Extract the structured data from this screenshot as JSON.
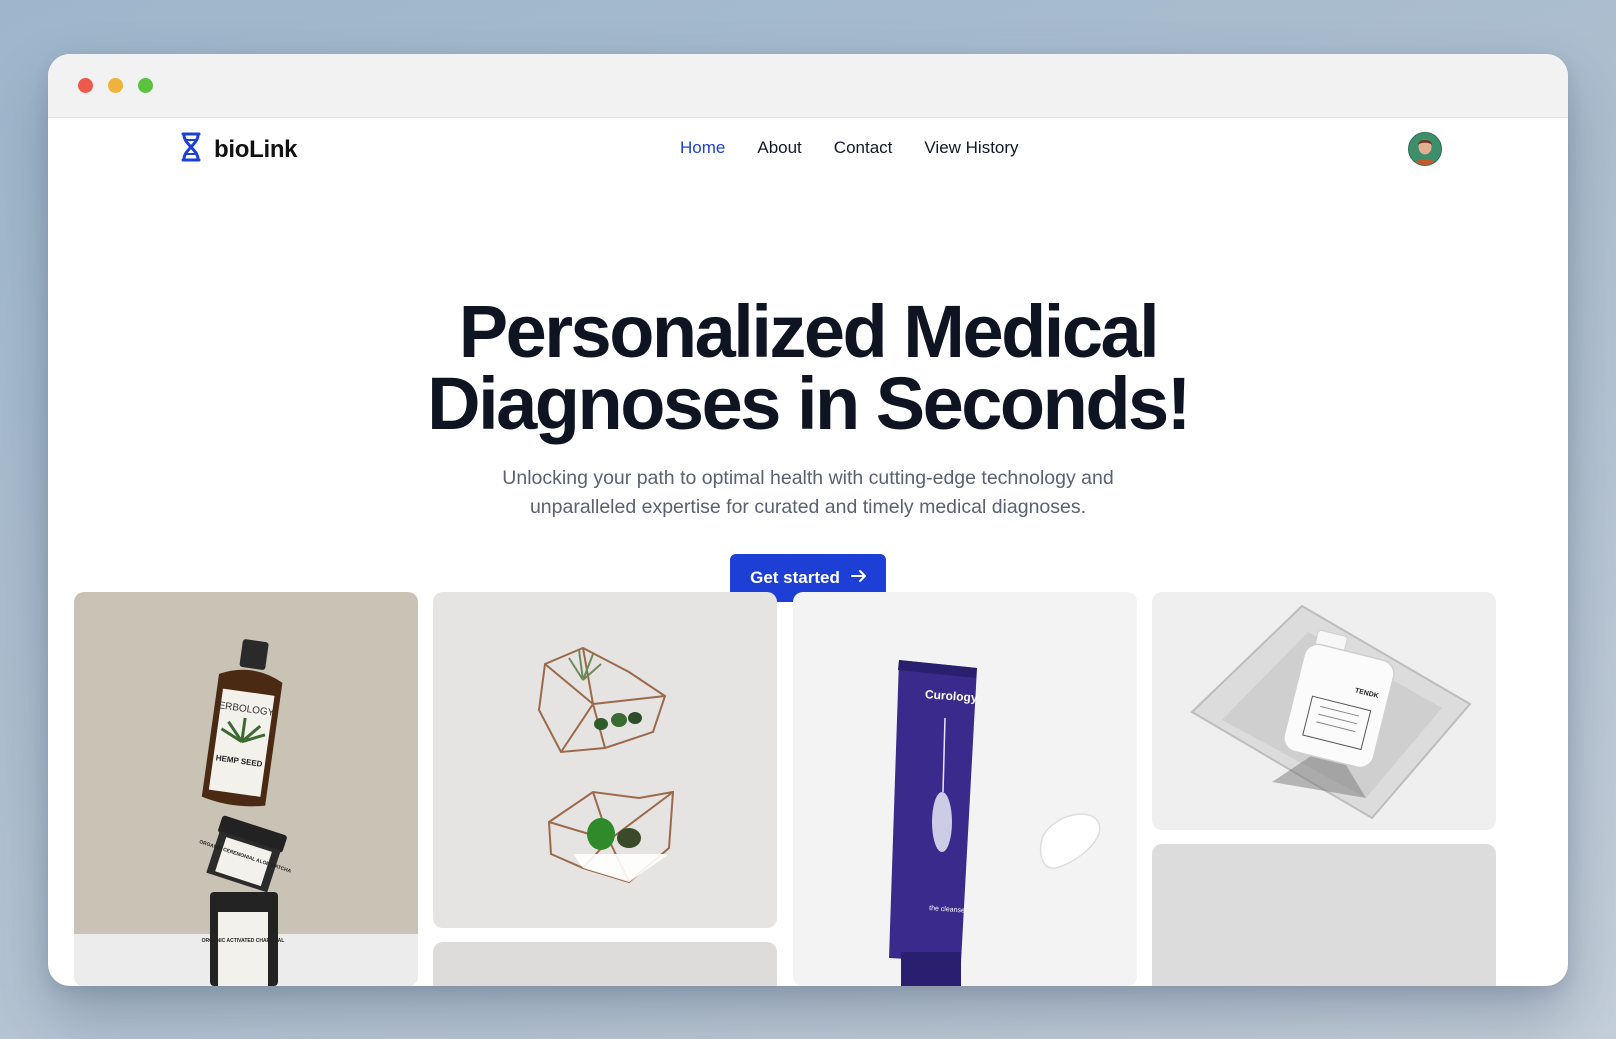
{
  "brand": {
    "name": "bioLink",
    "logo_icon": "dna-icon",
    "accent": "#1d3fd6"
  },
  "nav": {
    "items": [
      {
        "label": "Home",
        "active": true
      },
      {
        "label": "About",
        "active": false
      },
      {
        "label": "Contact",
        "active": false
      },
      {
        "label": "View History",
        "active": false
      }
    ],
    "avatar_icon": "user-avatar"
  },
  "hero": {
    "title_line1": "Personalized Medical",
    "title_line2": "Diagnoses in Seconds!",
    "subtitle": "Unlocking your path to optimal health with cutting-edge technology and unparalleled expertise for curated and timely medical diagnoses.",
    "cta_label": "Get started",
    "cta_icon": "arrow-right-icon"
  },
  "gallery": {
    "tiles": [
      {
        "subject": "product-bottles-photo",
        "texts": [
          "ERBOLOGY",
          "HEMP SEED",
          "ORGANIC CEREMONIAL ALOE MATCHA",
          "ORGANIC ACTIVATED CHARCOAL"
        ]
      },
      {
        "subject": "terrarium-photo"
      },
      {
        "subject": "cleanser-tube-photo",
        "texts": [
          "Curology",
          "the cleanser"
        ]
      },
      {
        "subject": "white-bottle-photo",
        "texts": [
          "TENDK"
        ]
      },
      {
        "subject": "placeholder-photo"
      },
      {
        "subject": "placeholder-photo"
      }
    ]
  }
}
